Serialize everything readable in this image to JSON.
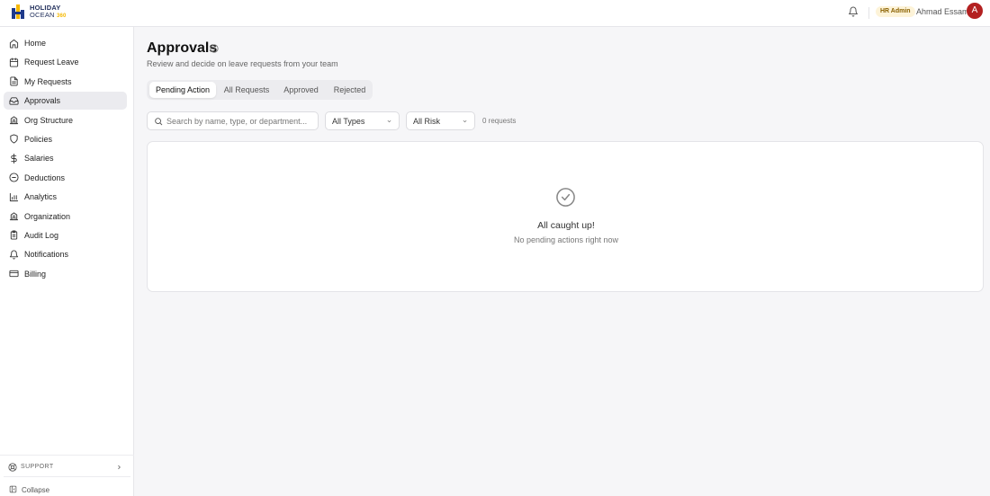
{
  "brand": {
    "line1": "HOLIDAY",
    "line2": "OCEAN",
    "suffix": "360",
    "colors": {
      "primary": "#1f3a8a",
      "accent": "#f5b800"
    }
  },
  "header": {
    "notifications_icon": "bell-icon",
    "role_badge": "HR Admin",
    "user_name": "Ahmad Essam",
    "avatar_initial": "A",
    "avatar_color": "#b32020"
  },
  "sidebar": {
    "items": [
      {
        "label": "Home",
        "icon": "home-icon",
        "active": false
      },
      {
        "label": "Request Leave",
        "icon": "calendar-icon",
        "active": false
      },
      {
        "label": "My Requests",
        "icon": "document-icon",
        "active": false
      },
      {
        "label": "Approvals",
        "icon": "inbox-icon",
        "active": true
      },
      {
        "label": "Org Structure",
        "icon": "building-icon",
        "active": false
      },
      {
        "label": "Policies",
        "icon": "shield-icon",
        "active": false
      },
      {
        "label": "Salaries",
        "icon": "dollar-icon",
        "active": false
      },
      {
        "label": "Deductions",
        "icon": "minus-circle-icon",
        "active": false
      },
      {
        "label": "Analytics",
        "icon": "bar-chart-icon",
        "active": false
      },
      {
        "label": "Organization",
        "icon": "building-icon",
        "active": false
      },
      {
        "label": "Audit Log",
        "icon": "clipboard-icon",
        "active": false
      },
      {
        "label": "Notifications",
        "icon": "bell-icon",
        "active": false
      },
      {
        "label": "Billing",
        "icon": "credit-card-icon",
        "active": false
      }
    ],
    "support_label": "SUPPORT",
    "collapse_label": "Collapse"
  },
  "main": {
    "title": "Approvals",
    "subtitle": "Review and decide on leave requests from your team",
    "tabs": [
      {
        "label": "Pending Action",
        "active": true
      },
      {
        "label": "All Requests",
        "active": false
      },
      {
        "label": "Approved",
        "active": false
      },
      {
        "label": "Rejected",
        "active": false
      }
    ],
    "search": {
      "placeholder": "Search by name, type, or department...",
      "value": ""
    },
    "type_filter": "All Types",
    "risk_filter": "All Risk",
    "request_count": "0 requests",
    "empty_state": {
      "title": "All caught up!",
      "message": "No pending actions right now"
    }
  }
}
